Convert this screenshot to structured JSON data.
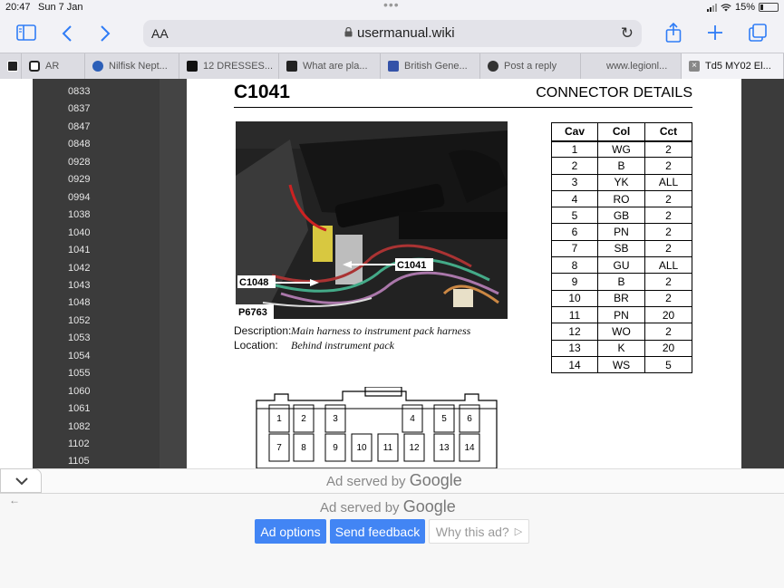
{
  "status": {
    "time": "20:47",
    "date": "Sun 7 Jan",
    "battery": "15%",
    "battery_level": 0.15
  },
  "toolbar": {
    "aa_label": "AA",
    "url": "usermanual.wiki"
  },
  "tabs": [
    {
      "label": "",
      "icon": "page-icon"
    },
    {
      "label": "AR",
      "icon": "page-icon"
    },
    {
      "label": "Nilfisk Nept...",
      "icon": "c-logo-icon"
    },
    {
      "label": "12 DRESSES...",
      "icon": "r-logo-icon"
    },
    {
      "label": "What are pla...",
      "icon": "grid-logo-icon"
    },
    {
      "label": "British Gene...",
      "icon": "flag-logo-icon"
    },
    {
      "label": "Post a reply",
      "icon": "mask-logo-icon"
    },
    {
      "label": "www.legionl...",
      "icon": ""
    },
    {
      "label": "Td5 MY02 El...",
      "icon": "close-icon"
    }
  ],
  "sidebar": {
    "items": [
      "0833",
      "0837",
      "0847",
      "0848",
      "0928",
      "0929",
      "0994",
      "1038",
      "1040",
      "1041",
      "1042",
      "1043",
      "1048",
      "1052",
      "1053",
      "1054",
      "1055",
      "1060",
      "1061",
      "1082",
      "1102",
      "1105"
    ]
  },
  "doc": {
    "code": "C1041",
    "heading": "CONNECTOR DETAILS",
    "photo_labels": {
      "ref": "P6763",
      "left_connector": "C1048",
      "right_connector": "C1041"
    },
    "description_label": "Description:",
    "description": "Main harness to instrument pack harness",
    "location_label": "Location:",
    "location": "Behind instrument pack",
    "table": {
      "headers": [
        "Cav",
        "Col",
        "Cct"
      ],
      "rows": [
        [
          "1",
          "WG",
          "2"
        ],
        [
          "2",
          "B",
          "2"
        ],
        [
          "3",
          "YK",
          "ALL"
        ],
        [
          "4",
          "RO",
          "2"
        ],
        [
          "5",
          "GB",
          "2"
        ],
        [
          "6",
          "PN",
          "2"
        ],
        [
          "7",
          "SB",
          "2"
        ],
        [
          "8",
          "GU",
          "ALL"
        ],
        [
          "9",
          "B",
          "2"
        ],
        [
          "10",
          "BR",
          "2"
        ],
        [
          "11",
          "PN",
          "20"
        ],
        [
          "12",
          "WO",
          "2"
        ],
        [
          "13",
          "K",
          "20"
        ],
        [
          "14",
          "WS",
          "5"
        ]
      ]
    },
    "pin_labels_top": [
      "1",
      "2",
      "3",
      "4",
      "5",
      "6"
    ],
    "pin_labels_bottom": [
      "7",
      "8",
      "9",
      "10",
      "11",
      "12",
      "13",
      "14"
    ]
  },
  "ads": {
    "served_by_1": "Ad served by",
    "google_1": "Google",
    "served_by_2": "Ad served by",
    "google_2": "Google",
    "ad_options": "Ad options",
    "send_feedback": "Send feedback",
    "why_this_ad": "Why this ad?"
  },
  "colors": {
    "accent": "#2f7cf6",
    "ad_button": "#4285f4"
  }
}
